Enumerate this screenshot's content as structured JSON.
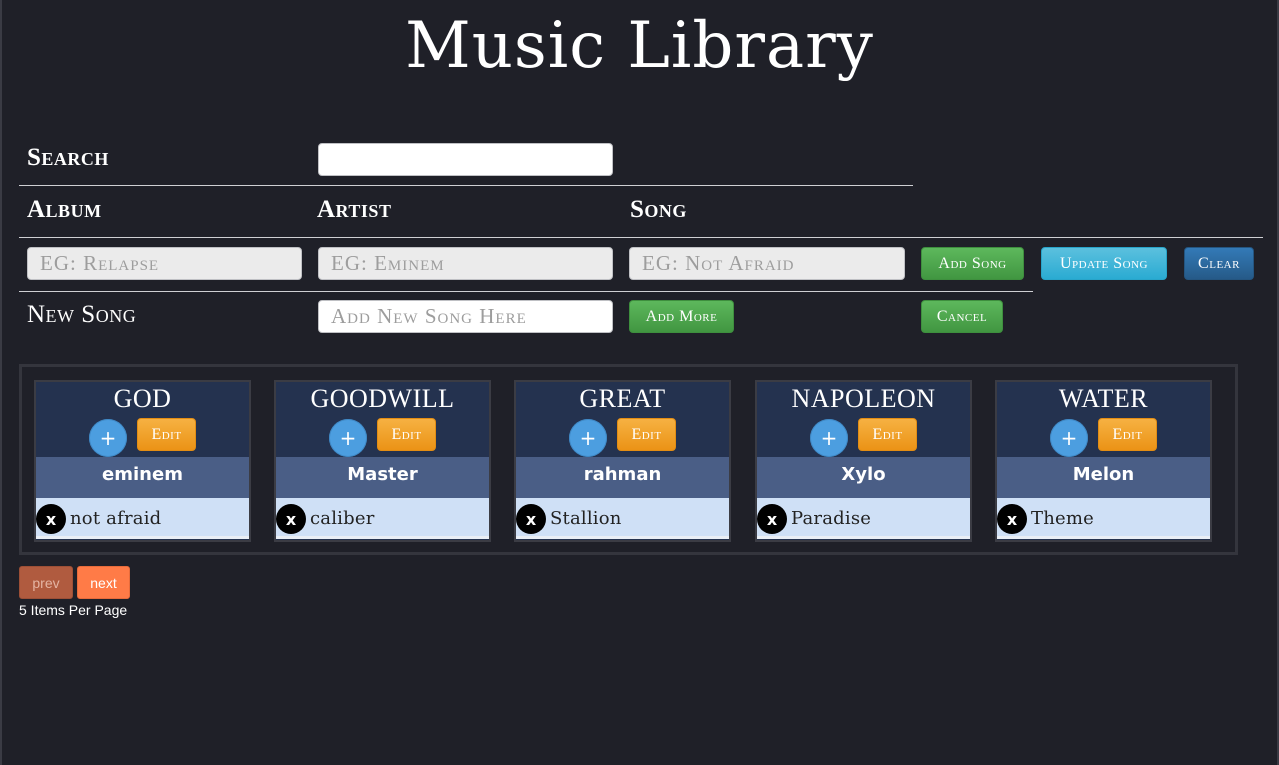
{
  "title": "Music Library",
  "form": {
    "search_label": "Search",
    "search_value": "",
    "album_label": "Album",
    "artist_label": "Artist",
    "song_label": "Song",
    "album_placeholder": "EG: Relapse",
    "artist_placeholder": "EG: Eminem",
    "song_placeholder": "EG: Not Afraid",
    "add_song_label": "Add Song",
    "update_song_label": "Update Song",
    "clear_label": "Clear",
    "new_song_label": "New Song",
    "new_song_placeholder": "Add New Song Here",
    "add_more_label": "Add More",
    "cancel_label": "Cancel"
  },
  "albums": [
    {
      "name": "GOD",
      "artist": "eminem",
      "songs": [
        "not afraid"
      ]
    },
    {
      "name": "GOODWILL",
      "artist": "Master",
      "songs": [
        "caliber"
      ]
    },
    {
      "name": "GREAT",
      "artist": "rahman",
      "songs": [
        "Stallion"
      ]
    },
    {
      "name": "NAPOLEON",
      "artist": "Xylo",
      "songs": [
        "Paradise"
      ]
    },
    {
      "name": "WATER",
      "artist": "Melon",
      "songs": [
        "Theme"
      ]
    }
  ],
  "card": {
    "plus_symbol": "+",
    "edit_label": "Edit",
    "delete_symbol": "x"
  },
  "pagination": {
    "prev_label": "prev",
    "next_label": "next",
    "per_page_text": "5 Items Per Page"
  },
  "colors": {
    "background": "#1f2028",
    "card_header": "#24324f",
    "artist_band": "#4a5e86",
    "song_row": "#cfe0f6",
    "green": "#4cae4c",
    "cyan": "#31b0d5",
    "blue": "#286090",
    "orange": "#f0a030"
  },
  "icons": [
    "plus-icon",
    "close-icon"
  ]
}
